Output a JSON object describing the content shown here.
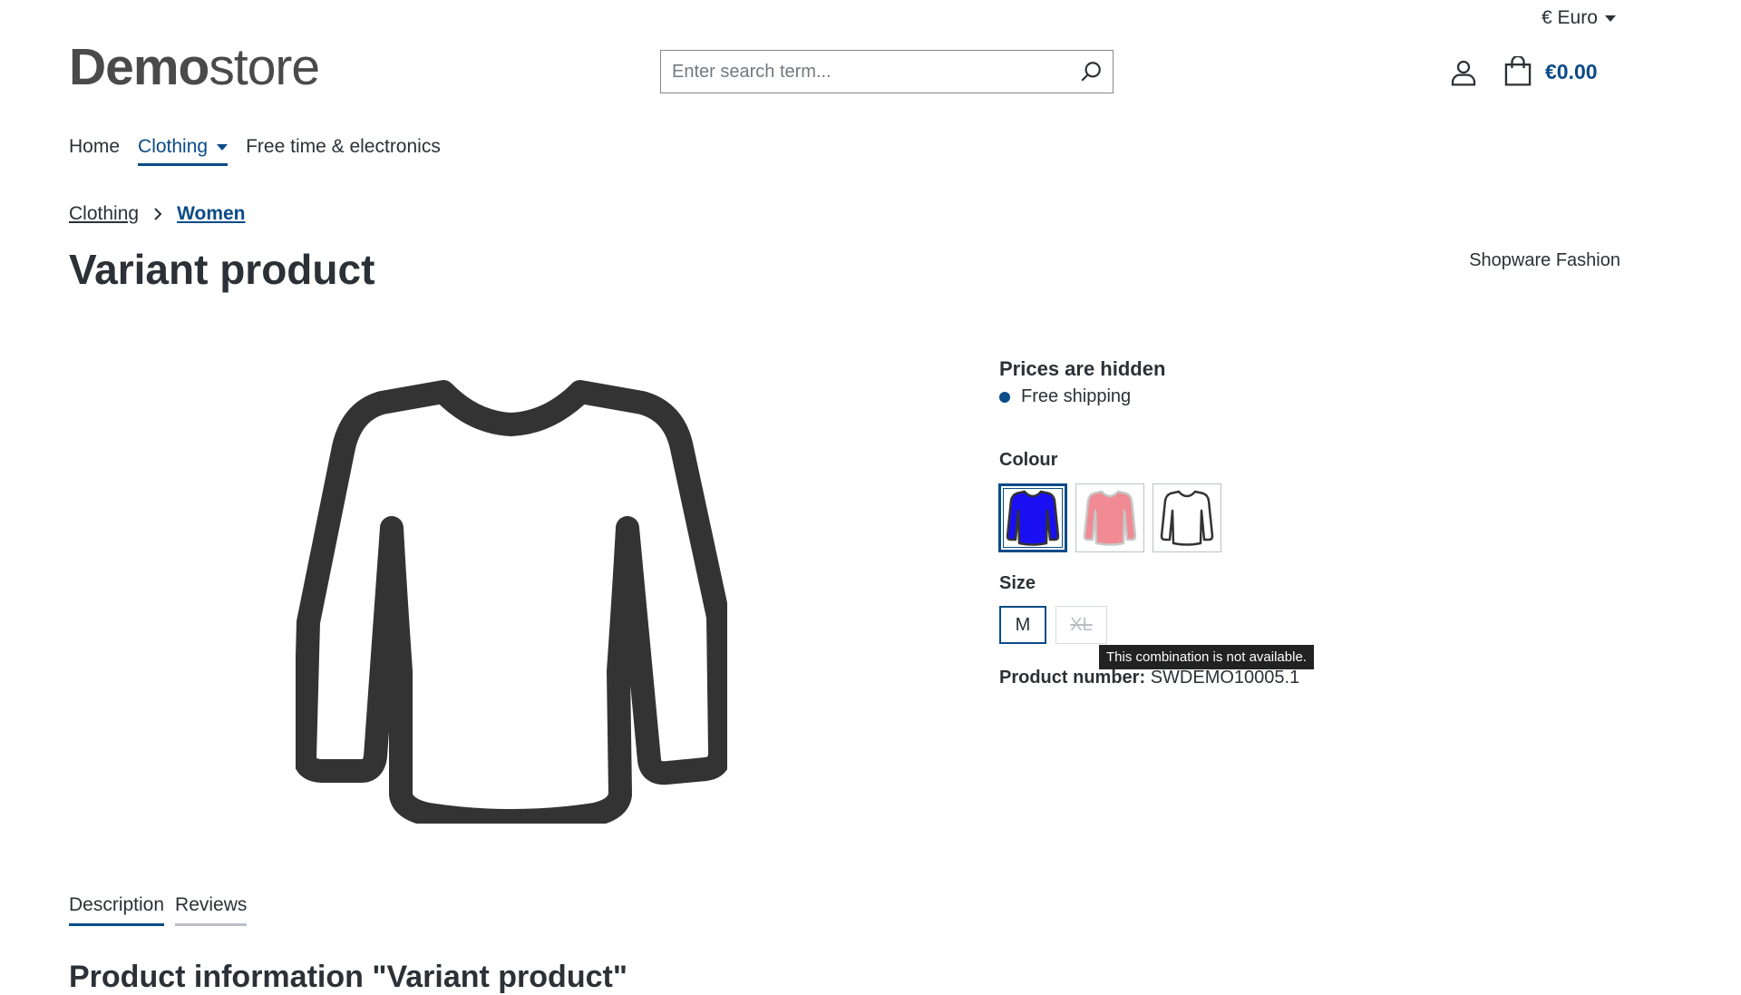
{
  "header": {
    "currency": "€ Euro",
    "logo_bold": "Demo",
    "logo_light": "store",
    "search_placeholder": "Enter search term...",
    "cart_total": "€0.00"
  },
  "nav": {
    "items": [
      {
        "label": "Home"
      },
      {
        "label": "Clothing"
      },
      {
        "label": "Free time & electronics"
      }
    ]
  },
  "breadcrumb": [
    "Clothing",
    "Women"
  ],
  "product": {
    "title": "Variant product",
    "manufacturer": "Shopware Fashion",
    "prices_hidden": "Prices are hidden",
    "shipping": "Free shipping",
    "colour_label": "Colour",
    "colours": [
      {
        "color": "#1a0ff2",
        "selected": true
      },
      {
        "color": "#f08a93",
        "selected": false
      },
      {
        "color": "#ffffff",
        "selected": false
      }
    ],
    "size_label": "Size",
    "sizes": [
      {
        "label": "M"
      },
      {
        "label": "XL"
      }
    ],
    "tooltip": "This combination is not available.",
    "number_label": "Product number:",
    "number_value": "SWDEMO10005.1"
  },
  "tabs": [
    "Description",
    "Reviews"
  ],
  "info_heading": "Product information \"Variant product\"",
  "colors": {
    "accent": "#0b4b88",
    "text": "#2b3136"
  }
}
